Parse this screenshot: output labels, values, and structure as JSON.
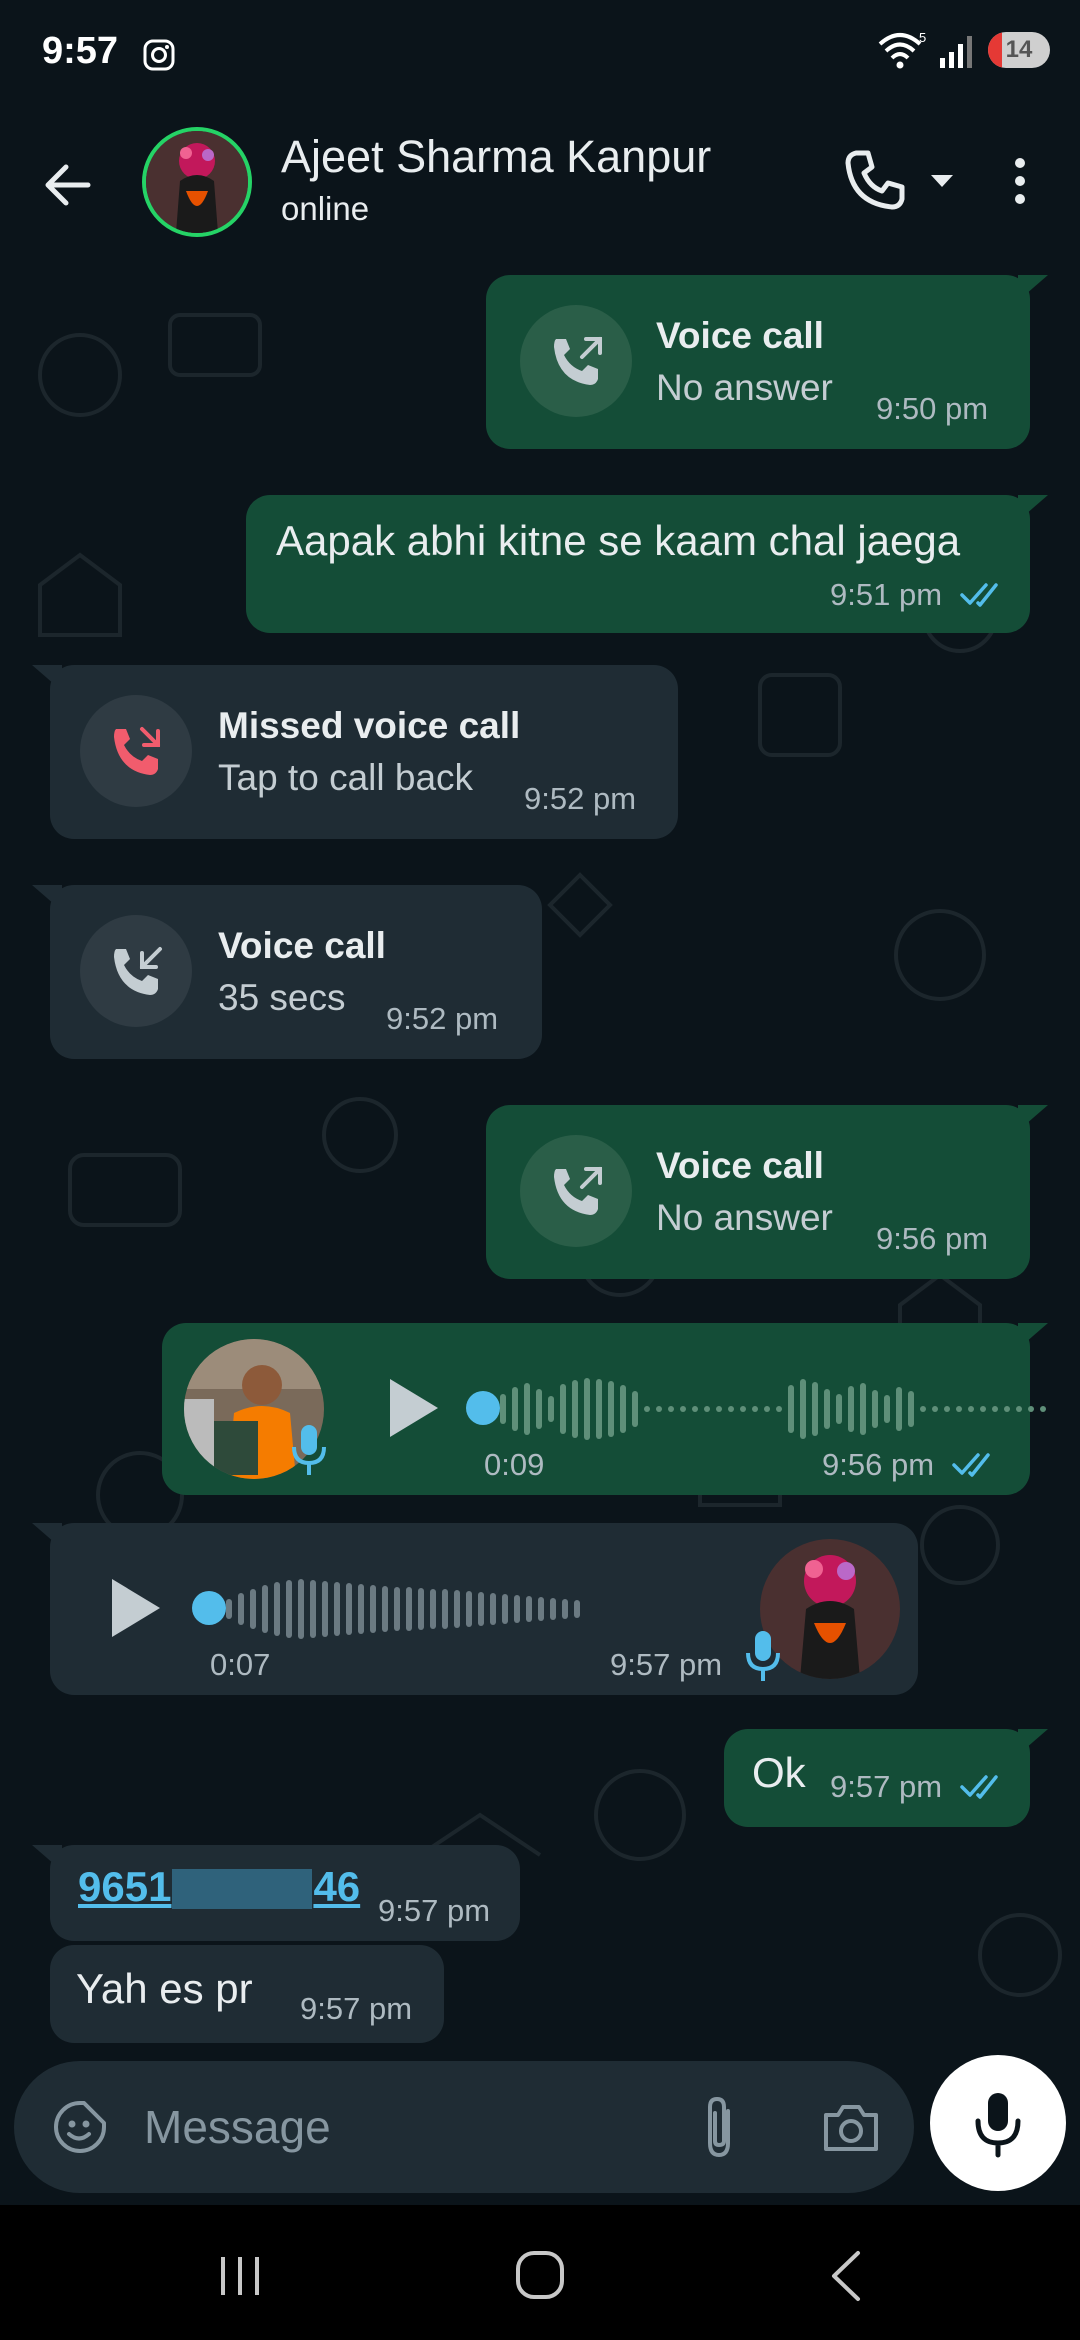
{
  "status_bar": {
    "time": "9:57",
    "instagram_icon": "instagram-icon",
    "wifi_icon": "wifi-icon",
    "wifi_badge": "5",
    "signal_icon": "signal-icon",
    "battery_level": "14"
  },
  "header": {
    "contact_name": "Ajeet Sharma Kanpur",
    "contact_status": "online",
    "back_icon": "back-arrow-icon",
    "call_icon": "phone-icon",
    "dropdown_icon": "chevron-down-icon",
    "menu_icon": "more-vert-icon"
  },
  "messages": [
    {
      "type": "call",
      "direction": "out",
      "title": "Voice call",
      "subtitle": "No answer",
      "time": "9:50 pm"
    },
    {
      "type": "text",
      "direction": "out",
      "text": "Aapak abhi kitne se kaam chal jaega",
      "time": "9:51 pm",
      "read": true
    },
    {
      "type": "call",
      "direction": "in",
      "title": "Missed voice call",
      "subtitle": "Tap to call back",
      "time": "9:52 pm",
      "missed": true
    },
    {
      "type": "call",
      "direction": "in",
      "title": "Voice call",
      "subtitle": "35 secs",
      "time": "9:52 pm"
    },
    {
      "type": "call",
      "direction": "out",
      "title": "Voice call",
      "subtitle": "No answer",
      "time": "9:56 pm"
    },
    {
      "type": "voice",
      "direction": "out",
      "duration": "0:09",
      "time": "9:56 pm",
      "read": true,
      "progress": 0
    },
    {
      "type": "voice",
      "direction": "in",
      "duration": "0:07",
      "time": "9:57 pm",
      "progress": 0
    },
    {
      "type": "text",
      "direction": "out",
      "text": "Ok",
      "time": "9:57 pm",
      "read": true
    },
    {
      "type": "link",
      "direction": "in",
      "text_start": "9651",
      "text_end": "46",
      "time": "9:57 pm"
    },
    {
      "type": "text",
      "direction": "in",
      "text": "Yah es pr",
      "time": "9:57 pm"
    }
  ],
  "composer": {
    "placeholder": "Message",
    "emoji_icon": "sticker-icon",
    "attach_icon": "paperclip-icon",
    "camera_icon": "camera-icon",
    "mic_icon": "mic-icon"
  },
  "nav_bar": {
    "recent_icon": "recent-apps-icon",
    "home_icon": "home-icon",
    "back_icon": "nav-back-icon"
  },
  "colors": {
    "background": "#0b141a",
    "outgoing_bubble": "#144d37",
    "incoming_bubble": "#1f2c34",
    "read_ticks": "#53bdeb",
    "missed_call": "#f15c6d",
    "online_ring": "#25d366"
  }
}
